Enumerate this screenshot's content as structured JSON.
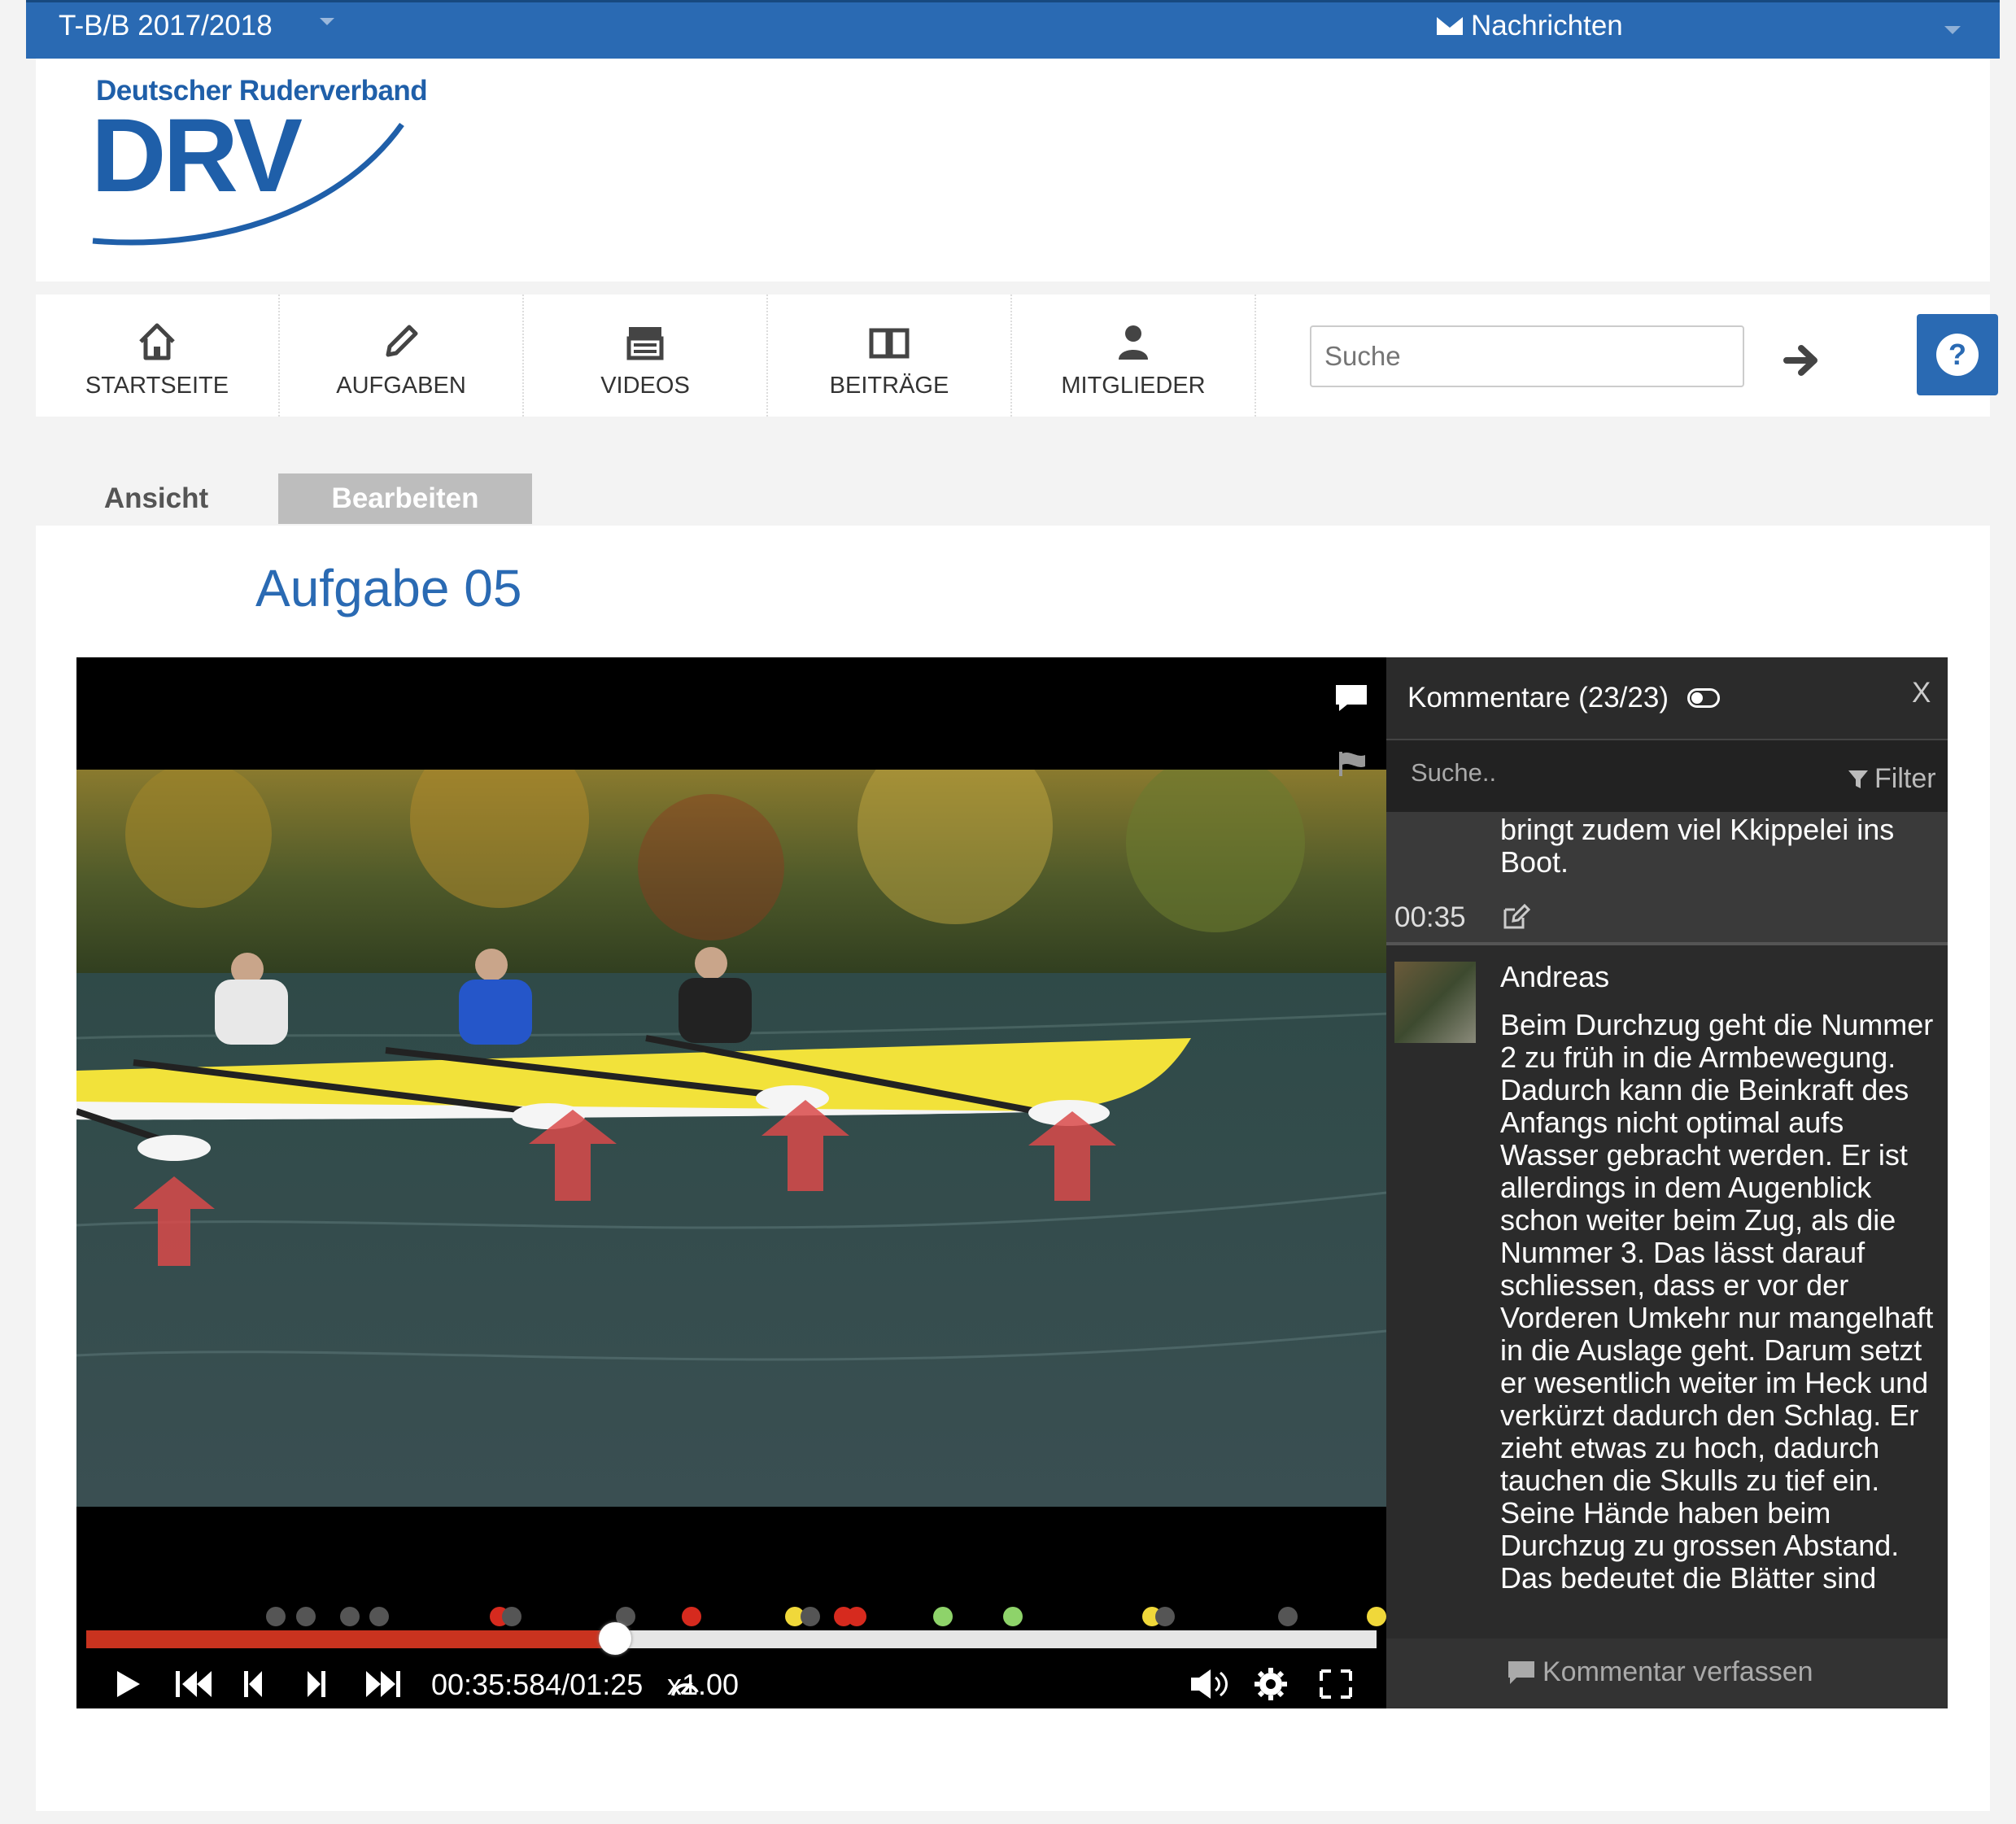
{
  "topbar": {
    "season": "T-B/B 2017/2018",
    "messages_label": "Nachrichten"
  },
  "logo": {
    "small_text": "Deutscher Ruderverband",
    "big_text": "DRV"
  },
  "nav": {
    "items": [
      {
        "label": "STARTSEITE",
        "icon": "home-icon"
      },
      {
        "label": "AUFGABEN",
        "icon": "pencil-icon"
      },
      {
        "label": "VIDEOS",
        "icon": "clapperboard-icon"
      },
      {
        "label": "BEITRÄGE",
        "icon": "book-icon"
      },
      {
        "label": "MITGLIEDER",
        "icon": "user-icon"
      }
    ],
    "search_placeholder": "Suche"
  },
  "tabs": {
    "view": "Ansicht",
    "edit": "Bearbeiten"
  },
  "page_title": "Aufgabe 05",
  "player": {
    "time": "00:35:584/01:25",
    "speed": "x1.00",
    "progress_fraction": 0.41,
    "markers": [
      {
        "pos": 0.147,
        "color": "#555555"
      },
      {
        "pos": 0.17,
        "color": "#555555"
      },
      {
        "pos": 0.204,
        "color": "#555555"
      },
      {
        "pos": 0.227,
        "color": "#555555"
      },
      {
        "pos": 0.32,
        "color": "#d62a1e"
      },
      {
        "pos": 0.33,
        "color": "#555555"
      },
      {
        "pos": 0.418,
        "color": "#555555"
      },
      {
        "pos": 0.469,
        "color": "#d62a1e"
      },
      {
        "pos": 0.549,
        "color": "#f0d83a"
      },
      {
        "pos": 0.561,
        "color": "#555555"
      },
      {
        "pos": 0.587,
        "color": "#d62a1e"
      },
      {
        "pos": 0.597,
        "color": "#d62a1e"
      },
      {
        "pos": 0.664,
        "color": "#8ed36a"
      },
      {
        "pos": 0.718,
        "color": "#8ed36a"
      },
      {
        "pos": 0.826,
        "color": "#f0d83a"
      },
      {
        "pos": 0.836,
        "color": "#555555"
      },
      {
        "pos": 0.931,
        "color": "#555555"
      },
      {
        "pos": 1.0,
        "color": "#f0d83a"
      }
    ]
  },
  "comments": {
    "title": "Kommentare (23/23)",
    "close": "X",
    "search_placeholder": "Suche..",
    "filter_label": "Filter",
    "first": {
      "text": "bringt zudem viel Kkippelei ins Boot.",
      "time": "00:35"
    },
    "second": {
      "author": "Andreas",
      "text": "Beim Durchzug geht die Nummer 2 zu früh in die Armbewegung. Dadurch kann die Beinkraft des Anfangs nicht optimal aufs Wasser gebracht werden. Er ist allerdings in dem Augenblick schon weiter beim Zug, als die Nummer 3. Das lässt darauf schliessen, dass er vor der Vorderen Umkehr nur mangelhaft in die Auslage geht. Darum setzt er wesentlich weiter im Heck und verkürzt dadurch den Schlag. Er zieht etwas zu hoch, dadurch tauchen die Skulls zu tief ein. Seine Hände haben beim Durchzug zu grossen Abstand. Das bedeutet die Blätter sind"
    },
    "write_label": "Kommentar verfassen"
  },
  "colors": {
    "brand_blue": "#2a6ab3",
    "progress_red": "#c9331f",
    "panel_dark": "#2b2b2b"
  }
}
